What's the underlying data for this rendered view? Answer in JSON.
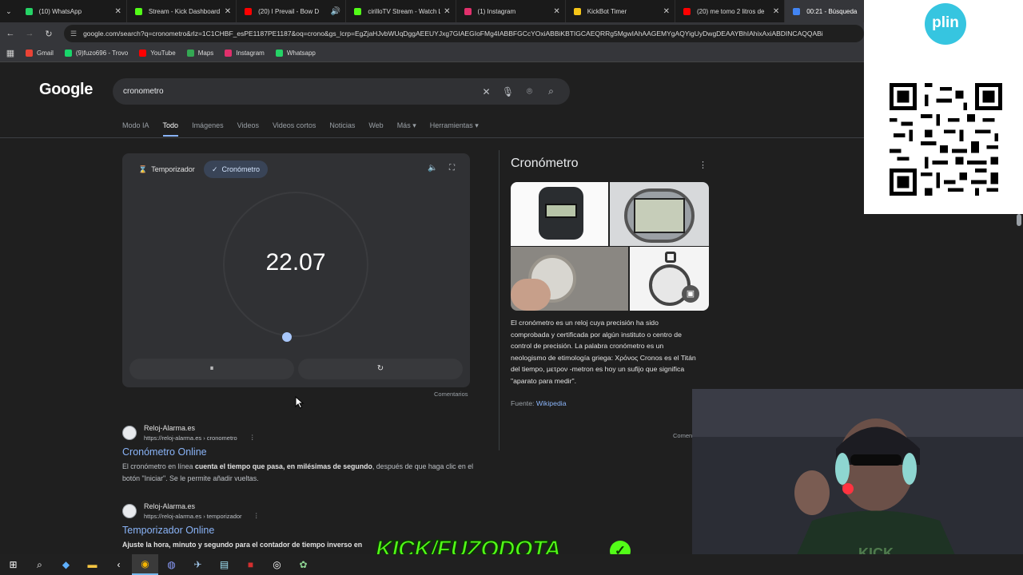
{
  "tabs": [
    {
      "label": "(10) WhatsApp",
      "color": "#25d366"
    },
    {
      "label": "Stream - Kick Dashboard",
      "color": "#53fc18"
    },
    {
      "label": "(20) I Prevail - Bow D",
      "color": "#ff0000"
    },
    {
      "label": "cirilloTV Stream - Watch L",
      "color": "#53fc18"
    },
    {
      "label": "(1) Instagram",
      "color": "#e1306c"
    },
    {
      "label": "KickBot Timer",
      "color": "#f5c518"
    },
    {
      "label": "(20) me tomo 2 litros de",
      "color": "#ff0000"
    },
    {
      "label": "00:21 - Búsqueda",
      "color": "#4285f4"
    }
  ],
  "address": {
    "url": "google.com/search?q=cronometro&rlz=1C1CHBF_esPE1187PE1187&oq=crono&gs_lcrp=EgZjaHJvbWUqDggAEEUYJxg7GIAEGIoFMg4IABBFGCcYOxiABBiKBTIGCAEQRRg5MgwIAhAAGEMYgAQYigUyDwgDEAAYBhIAhixAxiABDINCAQQABi"
  },
  "bookmarks": [
    {
      "label": "Gmail",
      "color": "#ea4335"
    },
    {
      "label": "(9)fuzo696 - Trovo",
      "color": "#19d66b"
    },
    {
      "label": "YouTube",
      "color": "#ff0000"
    },
    {
      "label": "Maps",
      "color": "#34a853"
    },
    {
      "label": "Instagram",
      "color": "#e1306c"
    },
    {
      "label": "Whatsapp",
      "color": "#25d366"
    }
  ],
  "google": {
    "logo": "Google",
    "query": "cronometro",
    "filters": [
      "Modo IA",
      "Todo",
      "Imágenes",
      "Videos",
      "Videos cortos",
      "Noticias",
      "Web",
      "Más",
      "Herramientas"
    ],
    "active_filter": "Todo"
  },
  "stopwatch": {
    "tab_timer": "Temporizador",
    "tab_stopwatch": "Cronómetro",
    "time": "22.07",
    "pause_label": "⏸",
    "reset_label": "↻",
    "feedback": "Comentarios",
    "progress_fraction": 0.37
  },
  "results": [
    {
      "site": "Reloj-Alarma.es",
      "url": "https://reloj-alarma.es › cronometro",
      "title": "Cronómetro Online",
      "snippet_pre": "El cronómetro en línea ",
      "snippet_bold": "cuenta el tiempo que pasa, en milésimas de segundo",
      "snippet_post": ", después de que haga clic en el botón \"Iniciar\". Se le permite añadir vueltas."
    },
    {
      "site": "Reloj-Alarma.es",
      "url": "https://reloj-alarma.es › temporizador",
      "title": "Temporizador Online",
      "snippet_pre": "",
      "snippet_bold": "Ajuste la hora, minuto y segundo para el contador de tiempo inverso en",
      "snippet_post": ""
    }
  ],
  "knowledge_panel": {
    "title": "Cronómetro",
    "description": "El cronómetro es un reloj cuya precisión ha sido comprobada y certificada por algún instituto o centro de control de precisión. La palabra cronómetro es un neologismo de etimología griega: Χρόνος Cronos es el Titán del tiempo, μετρον -metron es hoy un sufijo que significa \"aparato para medir\".",
    "source_label": "Fuente: ",
    "source_link": "Wikipedia",
    "feedback": "Comentarios"
  },
  "overlay": {
    "plin_logo": "plin",
    "kick_text": "KICK/FUZODOTA"
  },
  "colors": {
    "accent": "#8ab4f8",
    "kick_green": "#53fc18",
    "plin_blue": "#36c5e0"
  }
}
